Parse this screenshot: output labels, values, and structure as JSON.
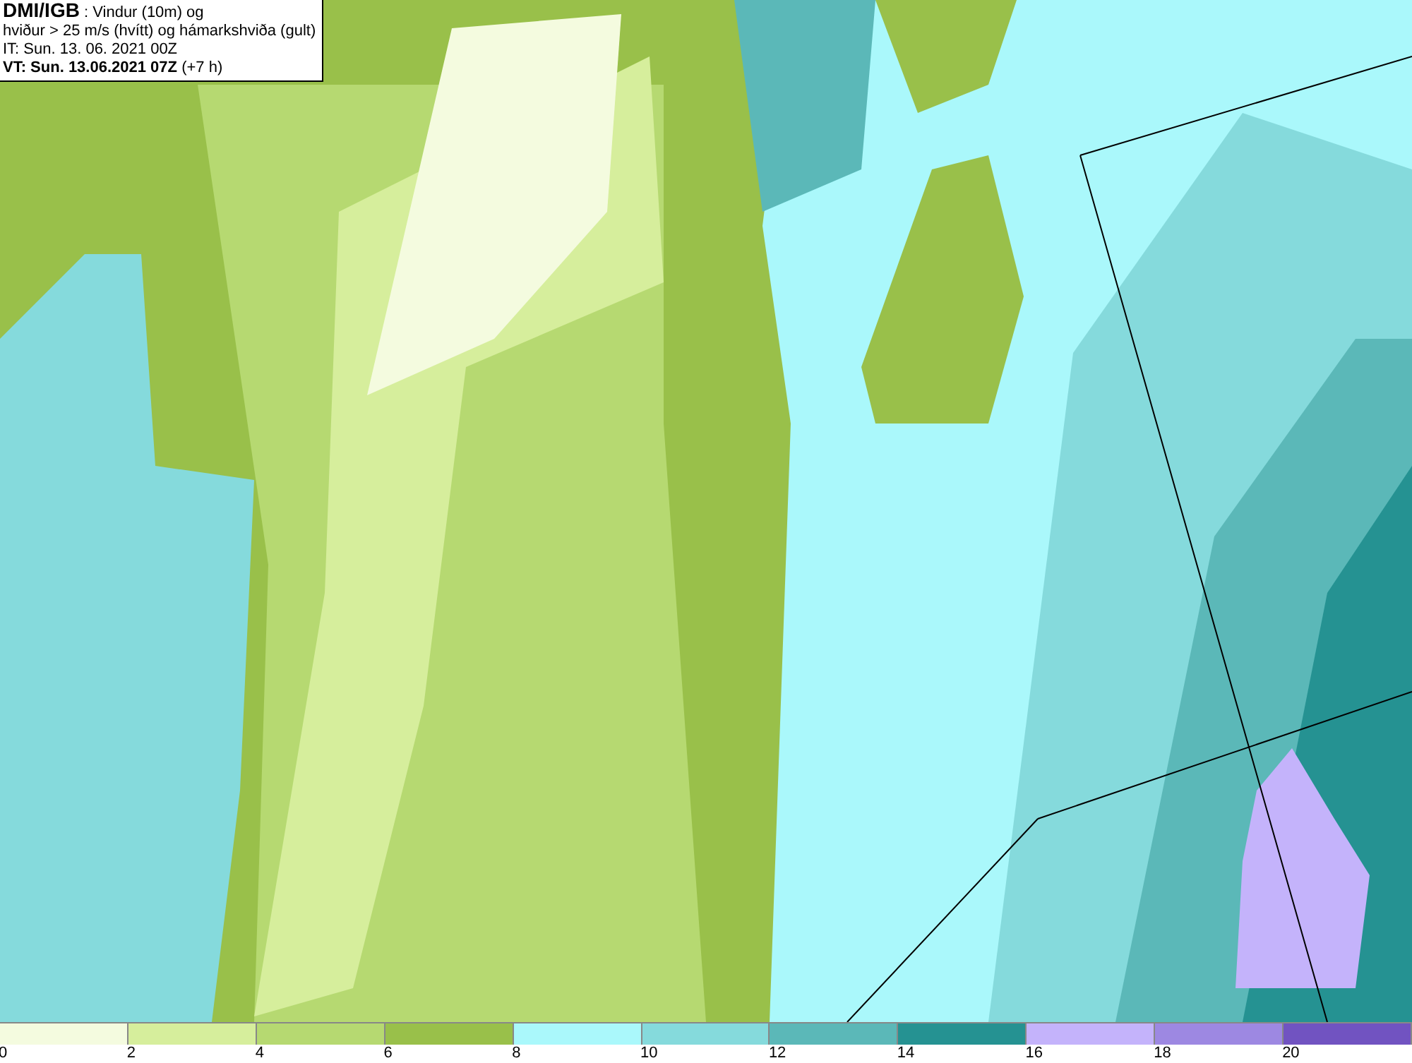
{
  "header": {
    "lines": [
      "**DMI/IGB** : Vindur (10m) og",
      "hviður > 25 m/s (hvítt) og hámarkshviða (gult)",
      "IT: Sun. 13. 06. 2021 00Z",
      "**VT: Sun. 13.06.2021 07Z** (+7 h)"
    ]
  },
  "legend": {
    "bins": [
      {
        "color": "#f4fbdf",
        "label": "0"
      },
      {
        "color": "#d6ee9c",
        "label": "2"
      },
      {
        "color": "#b6d971",
        "label": "4"
      },
      {
        "color": "#99c04a",
        "label": "6"
      },
      {
        "color": "#aaf8fb",
        "label": "8"
      },
      {
        "color": "#85dadc",
        "label": "10"
      },
      {
        "color": "#5bb8b8",
        "label": "12"
      },
      {
        "color": "#259292",
        "label": "14"
      },
      {
        "color": "#c4b3fb",
        "label": "16"
      },
      {
        "color": "#9d88e2",
        "label": "18"
      },
      {
        "color": "#7153c1",
        "label": "20"
      }
    ]
  }
}
